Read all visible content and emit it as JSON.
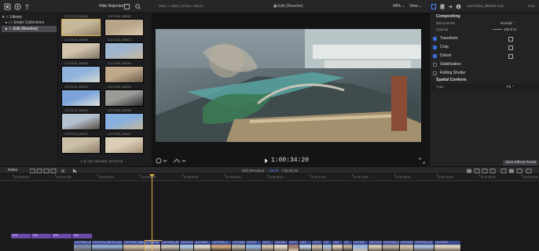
{
  "toolbar": {
    "filter_label": "Hide Rejected",
    "video_format": "3840 × 1920 | 24 fps, Stereo",
    "project_title": "Edit (Resolve)",
    "zoom_level": "44%",
    "view_label": "View",
    "clip_name": "12272018_093403.mov",
    "clip_duration": "5:04"
  },
  "sidebar": {
    "library_label": "Library",
    "items": [
      {
        "label": "Smart Collections"
      },
      {
        "label": "Edit (Resolve)"
      }
    ]
  },
  "browser": {
    "clips": [
      {
        "name": "12272018_083436",
        "colors": [
          "#c8b89a",
          "#8a7b66"
        ]
      },
      {
        "name": "12272018_083452",
        "colors": [
          "#b7a58a",
          "#d8c9ad"
        ]
      },
      {
        "name": "12272018_083726",
        "colors": [
          "#d2c4ac",
          "#7a6f62"
        ]
      },
      {
        "name": "12272018_083813",
        "colors": [
          "#9fb6cf",
          "#c9b79a"
        ]
      },
      {
        "name": "12272018_083833",
        "colors": [
          "#8fb3dc",
          "#d8d6cf"
        ]
      },
      {
        "name": "12272018_083904",
        "colors": [
          "#bfa98a",
          "#6c5d4e"
        ]
      },
      {
        "name": "12272018_083939",
        "colors": [
          "#7ca4da",
          "#e2e2dc"
        ]
      },
      {
        "name": "12272018_083940",
        "colors": [
          "#9b9b98",
          "#2f2f2f"
        ]
      },
      {
        "name": "12272018_084002",
        "colors": [
          "#b4c2d0",
          "#564a3e"
        ]
      },
      {
        "name": "12272018_084008",
        "colors": [
          "#87afe0",
          "#c7b89d"
        ]
      },
      {
        "name": "12272018_084021",
        "colors": [
          "#cbbfa8",
          "#8c7d68"
        ]
      },
      {
        "name": "12272018_084047",
        "colors": [
          "#d9cdb8",
          "#a38f73"
        ]
      }
    ],
    "selection_status": "1 of 122 selected, 00:03:19"
  },
  "viewer": {
    "timecode": "1:00:34:20"
  },
  "inspector": {
    "section_title": "Compositing",
    "blend_mode_label": "Blend Mode",
    "blend_mode_value": "Normal",
    "opacity_label": "Opacity",
    "opacity_value": "100.0",
    "opacity_unit": "%",
    "sections": [
      {
        "label": "Transform",
        "checked": true
      },
      {
        "label": "Crop",
        "checked": true
      },
      {
        "label": "Distort",
        "checked": true
      },
      {
        "label": "Stabilization",
        "checked": false
      },
      {
        "label": "Rolling Shutter",
        "checked": false
      }
    ],
    "spatial_title": "Spatial Conform",
    "type_label": "Type",
    "type_value": "Fit",
    "save_button": "Save Effects Preset"
  },
  "timeline": {
    "index_label": "Index",
    "project_name": "Edit (Resolve)",
    "position": "06:04",
    "duration": "02:03:15",
    "ruler_ticks": [
      "01:00:00:00",
      "01:00:10:00",
      "01:00:20:00",
      "01:00:30:00",
      "01:00:40:00",
      "01:00:50:00",
      "01:01:00:00",
      "01:01:10:00",
      "01:01:20:00",
      "01:01:30:00",
      "01:01:40:00",
      "01:01:50:00",
      "01:02:00:00"
    ],
    "markers": [
      {
        "label": "Roll"
      },
      {
        "label": "Roll"
      },
      {
        "label": "Roll"
      },
      {
        "label": "Roll"
      }
    ],
    "clips": [
      {
        "name": "12272018_08",
        "colors": [
          "#7a8aa5",
          "#5f5a50"
        ]
      },
      {
        "name": "12272018_084701.mov",
        "colors": [
          "#8ea6c8",
          "#3a3a3a"
        ]
      },
      {
        "name": "12272018_0850",
        "colors": [
          "#c4b39a",
          "#6d5e4f"
        ]
      },
      {
        "name": "12272018",
        "colors": [
          "#d3c6b3",
          "#8b7b66"
        ]
      },
      {
        "name": "12272018_08",
        "colors": [
          "#bdb9b0",
          "#524a42"
        ]
      },
      {
        "name": "12272018",
        "colors": [
          "#a9c0dc",
          "#7c6e5c"
        ]
      },
      {
        "name": "12272018",
        "colors": [
          "#d6d0c6",
          "#615547"
        ]
      },
      {
        "name": "12272018_0",
        "colors": [
          "#c7a07a",
          "#3b3026"
        ]
      },
      {
        "name": "12272018",
        "colors": [
          "#b8b0a4",
          "#4d453c"
        ]
      },
      {
        "name": "122720",
        "colors": [
          "#8fb0d9",
          "#6e6253"
        ]
      },
      {
        "name": "12272",
        "colors": [
          "#c9bca8",
          "#5a4f43"
        ]
      },
      {
        "name": "1227201",
        "colors": [
          "#d8d0c2",
          "#7f715f"
        ]
      },
      {
        "name": "12272",
        "colors": [
          "#9e7a6a",
          "#d4c3a8"
        ]
      },
      {
        "name": "1227",
        "colors": [
          "#b7c7d8",
          "#4b433a"
        ]
      },
      {
        "name": "12272",
        "colors": [
          "#c1b6a6",
          "#675a4b"
        ]
      },
      {
        "name": "122",
        "colors": [
          "#a7bbd4",
          "#8a7a66"
        ]
      },
      {
        "name": "1227",
        "colors": [
          "#d0c4b0",
          "#5c5043"
        ]
      },
      {
        "name": "122",
        "colors": [
          "#b5a894",
          "#3f372f"
        ]
      },
      {
        "name": "1227201",
        "colors": [
          "#98b4dc",
          "#c2b49d"
        ]
      },
      {
        "name": "12272018",
        "colors": [
          "#cec3b1",
          "#6a5d4d"
        ]
      },
      {
        "name": "12272018_09",
        "colors": [
          "#b4aa9b",
          "#4e463d"
        ]
      },
      {
        "name": "12272018",
        "colors": [
          "#c6bba9",
          "#7a6c5a"
        ]
      },
      {
        "name": "12272018_09",
        "colors": [
          "#a4b8d2",
          "#5a5046"
        ]
      },
      {
        "name": "12272018",
        "colors": [
          "#d4cab9",
          "#6f6252"
        ]
      }
    ]
  },
  "colors": {
    "accent": "#3a6cd6",
    "playhead": "#d7b24a",
    "marker": "#6a4aa8",
    "clip_header": "#3c4a8f"
  }
}
